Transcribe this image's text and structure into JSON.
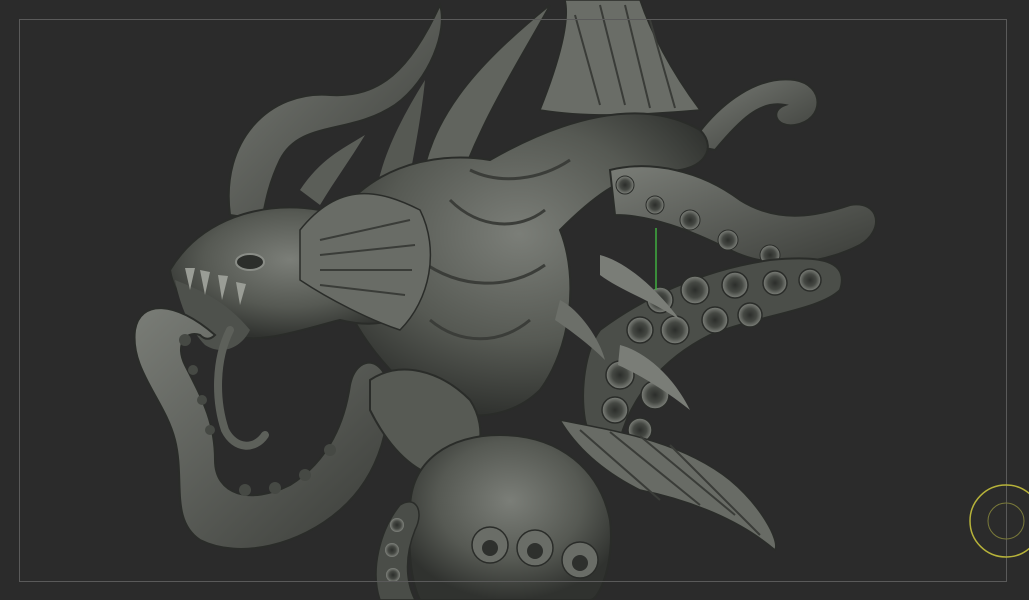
{
  "viewport": {
    "background": "#2b2b2b",
    "frame_color": "#5a5a5a",
    "axis_color": "#3fae3f"
  },
  "model": {
    "subject": "sculpted-sea-creature",
    "material_color": "#5f625d",
    "highlight_color": "#8a8d87",
    "shadow_color": "#2f312e"
  },
  "gizmo": {
    "icon": "navigation-ring-icon",
    "color": "#b7b33a"
  }
}
